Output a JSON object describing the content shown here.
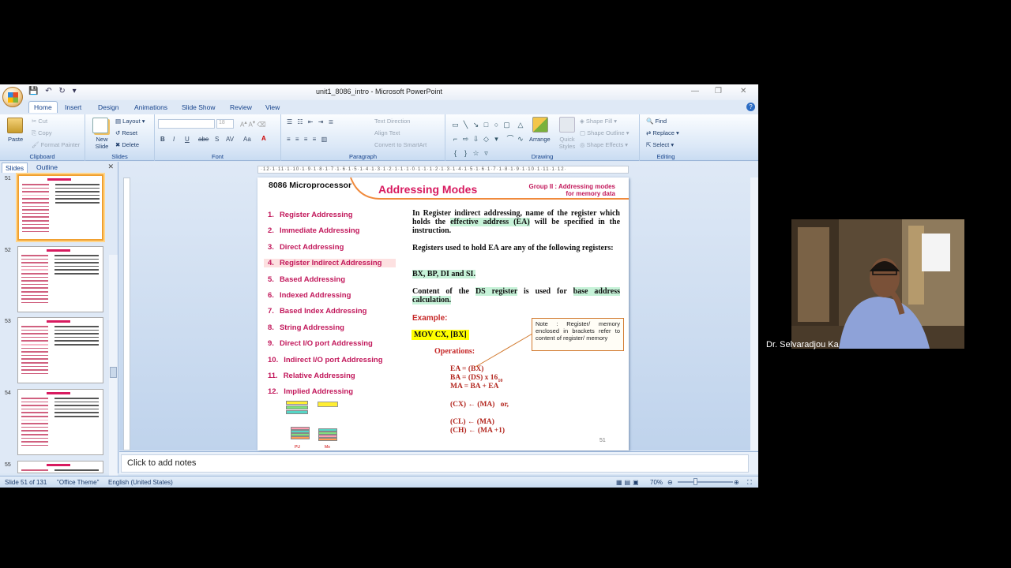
{
  "window": {
    "title": "unit1_8086_intro - Microsoft PowerPoint"
  },
  "tabs": [
    "Home",
    "Insert",
    "Design",
    "Animations",
    "Slide Show",
    "Review",
    "View"
  ],
  "ribbon": {
    "clipboard": {
      "paste": "Paste",
      "cut": "Cut",
      "copy": "Copy",
      "format_painter": "Format Painter",
      "label": "Clipboard"
    },
    "slides": {
      "new_slide": "New Slide",
      "layout": "Layout",
      "reset": "Reset",
      "delete": "Delete",
      "label": "Slides"
    },
    "font": {
      "size": "18",
      "label": "Font"
    },
    "paragraph": {
      "text_direction": "Text Direction",
      "align_text": "Align Text",
      "smartart": "Convert to SmartArt",
      "label": "Paragraph"
    },
    "drawing": {
      "arrange": "Arrange",
      "quick_styles": "Quick Styles",
      "shape_fill": "Shape Fill",
      "shape_outline": "Shape Outline",
      "shape_effects": "Shape Effects",
      "label": "Drawing"
    },
    "editing": {
      "find": "Find",
      "replace": "Replace",
      "select": "Select",
      "label": "Editing"
    }
  },
  "left_panel": {
    "tab_slides": "Slides",
    "tab_outline": "Outline",
    "thumb_numbers": [
      "51",
      "52",
      "53",
      "54",
      "55"
    ]
  },
  "ruler": {
    "marks": "·12·1·11·1·10·1·9·1·8·1·7·1·6·1·5·1·4·1·3·1·2·1·1·1·0·1·1·1·2·1·3·1·4·1·5·1·6·1·7·1·8·1·9·1·10·1·11·1·12·"
  },
  "slide": {
    "header_left": "8086 Microprocessor",
    "title": "Addressing Modes",
    "group_line1": "Group II : Addressing modes",
    "group_line2": "for memory data",
    "modes": [
      {
        "num": "1.",
        "label": "Register Addressing"
      },
      {
        "num": "2.",
        "label": "Immediate Addressing"
      },
      {
        "num": "3.",
        "label": "Direct Addressing"
      },
      {
        "num": "4.",
        "label": "Register Indirect Addressing"
      },
      {
        "num": "5.",
        "label": "Based Addressing"
      },
      {
        "num": "6.",
        "label": "Indexed Addressing"
      },
      {
        "num": "7.",
        "label": "Based Index Addressing"
      },
      {
        "num": "8.",
        "label": "String Addressing"
      },
      {
        "num": "9.",
        "label": "Direct I/O port Addressing"
      },
      {
        "num": "10.",
        "label": "Indirect I/O port Addressing"
      },
      {
        "num": "11.",
        "label": "Relative Addressing"
      },
      {
        "num": "12.",
        "label": "Implied Addressing"
      }
    ],
    "para1_a": "In Register indirect addressing, name of the register which holds the",
    "para1_hl": "effective address (EA)",
    "para1_b": "will be specified in the instruction.",
    "para2": "Registers used to hold EA are any of the following registers:",
    "regs": "BX, BP, DI and SI.",
    "para3_a": "Content of the",
    "para3_hl": "DS register",
    "para3_b": "is used for",
    "para3_hl2": "base address calculation.",
    "example_label": "Example:",
    "example_code": "MOV CX, [BX]",
    "operations_label": "Operations:",
    "ops": {
      "ea": "EA = (BX)",
      "ba": "BA = (DS) x 16",
      "ba_sub": "10",
      "ma": "MA = BA + EA",
      "cx": "(CX) ← (MA)   or,",
      "cl": "(CL) ← (MA)",
      "ch": "(CH) ← (MA +1)"
    },
    "note": "Note : Register/ memory enclosed in brackets refer to content of register/ memory",
    "page_number": "51",
    "mini_labels": [
      "PU",
      "Mo"
    ]
  },
  "notes": {
    "placeholder": "Click to add notes"
  },
  "status": {
    "slide": "Slide 51 of 131",
    "theme": "\"Office Theme\"",
    "language": "English (United States)",
    "zoom": "70%"
  },
  "webcam": {
    "name": "Dr. Selvaradjou Ka"
  }
}
